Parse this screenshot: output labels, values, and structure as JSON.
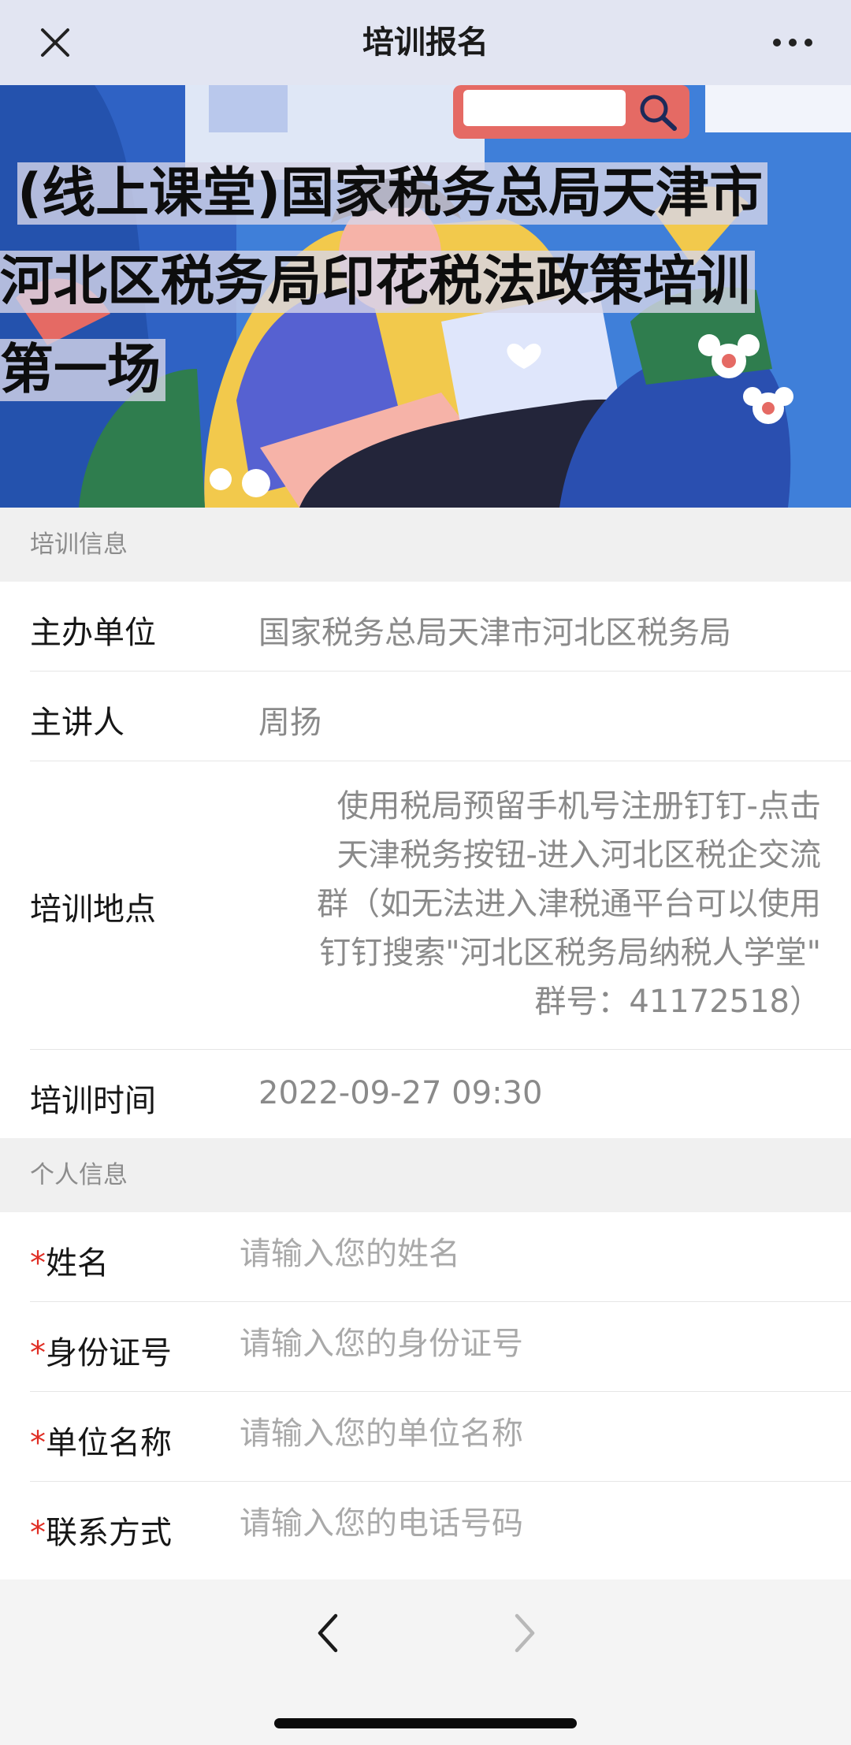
{
  "nav": {
    "title": "培训报名",
    "close_icon": "close-icon",
    "more_icon": "more-icon"
  },
  "banner": {
    "title_lines": [
      "(线上课堂)国家税务总局天津市",
      "河北区税务局印花税法政策培训",
      "第一场"
    ]
  },
  "training_info": {
    "section_title": "培训信息",
    "organizer_label": "主办单位",
    "organizer_value": "国家税务总局天津市河北区税务局",
    "speaker_label": "主讲人",
    "speaker_value": "周扬",
    "location_label": "培训地点",
    "location_lines": [
      "使用税局预留手机号注册钉钉-点击",
      "天津税务按钮-进入河北区税企交流",
      "群（如无法进入津税通平台可以使用",
      "钉钉搜索\"河北区税务局纳税人学堂\"",
      "群号：41172518）"
    ],
    "time_label": "培训时间",
    "time_value": "2022-09-27 09:30"
  },
  "personal_info": {
    "section_title": "个人信息",
    "required_mark": "*",
    "name_label": "姓名",
    "name_placeholder": "请输入您的姓名",
    "id_label": "身份证号",
    "id_placeholder": "请输入您的身份证号",
    "company_label": "单位名称",
    "company_placeholder": "请输入您的单位名称",
    "contact_label": "联系方式",
    "contact_placeholder": "请输入您的电话号码"
  },
  "toolbar": {
    "back_icon": "chevron-left-icon",
    "forward_icon": "chevron-right-icon"
  },
  "colors": {
    "nav_bg": "#e2e5f2",
    "required": "#e02e24",
    "banner_blue": "#3f7fd9"
  }
}
